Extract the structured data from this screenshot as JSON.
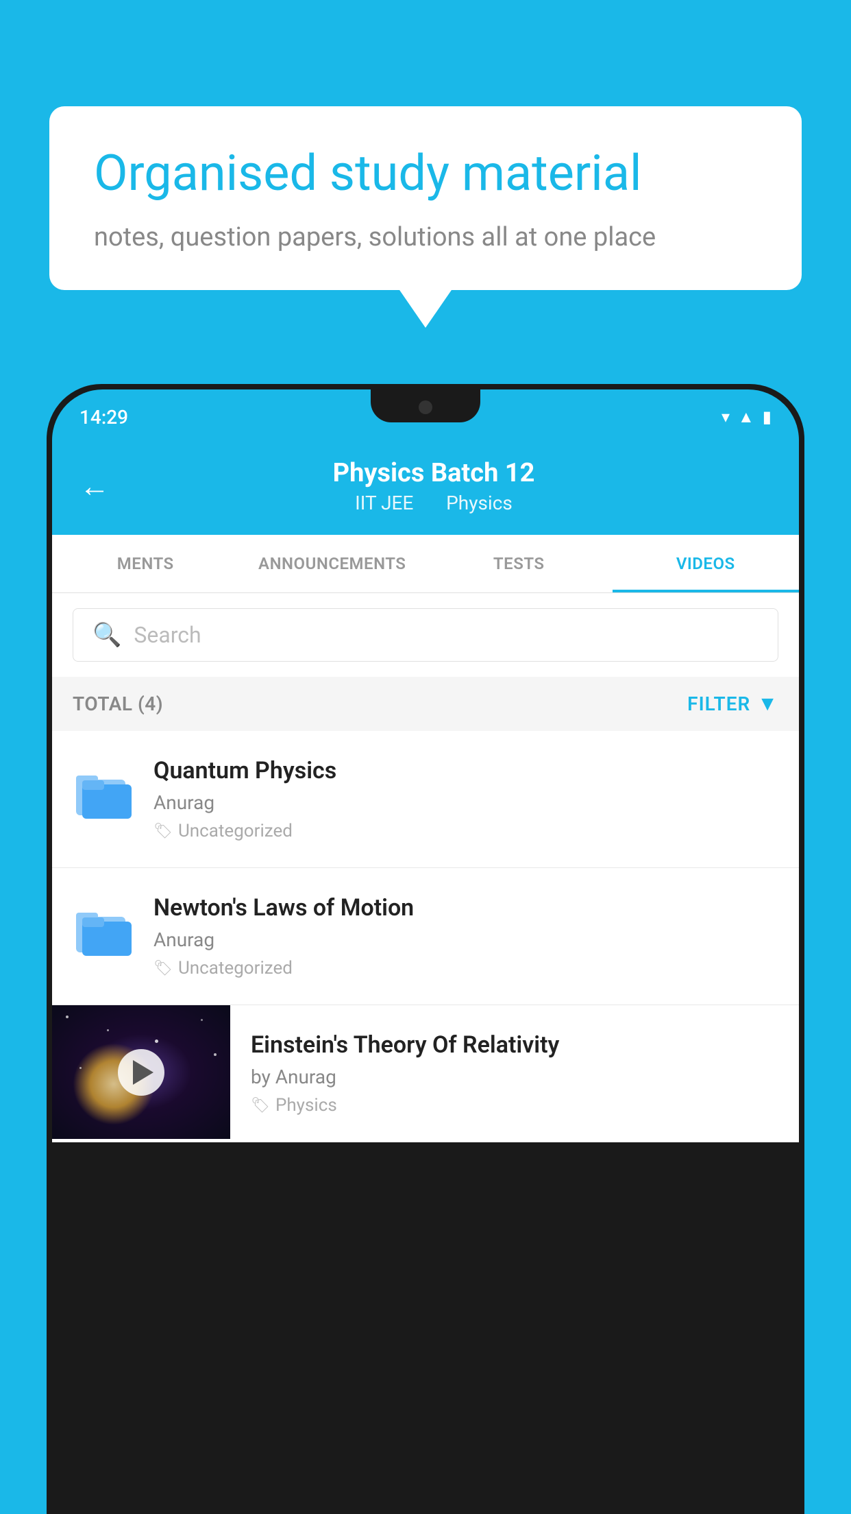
{
  "background_color": "#1ab8e8",
  "speech_bubble": {
    "title": "Organised study material",
    "subtitle": "notes, question papers, solutions all at one place"
  },
  "status_bar": {
    "time": "14:29",
    "icons": [
      "wifi",
      "signal",
      "battery"
    ]
  },
  "top_nav": {
    "back_label": "←",
    "title": "Physics Batch 12",
    "subtitle_left": "IIT JEE",
    "subtitle_right": "Physics"
  },
  "tabs": [
    {
      "label": "MENTS",
      "active": false
    },
    {
      "label": "ANNOUNCEMENTS",
      "active": false
    },
    {
      "label": "TESTS",
      "active": false
    },
    {
      "label": "VIDEOS",
      "active": true
    }
  ],
  "search": {
    "placeholder": "Search"
  },
  "filter_row": {
    "total_label": "TOTAL (4)",
    "filter_label": "FILTER"
  },
  "video_items": [
    {
      "title": "Quantum Physics",
      "author": "Anurag",
      "tag": "Uncategorized",
      "type": "folder"
    },
    {
      "title": "Newton's Laws of Motion",
      "author": "Anurag",
      "tag": "Uncategorized",
      "type": "folder"
    },
    {
      "title": "Einstein's Theory Of Relativity",
      "author": "by Anurag",
      "tag": "Physics",
      "type": "video"
    }
  ]
}
